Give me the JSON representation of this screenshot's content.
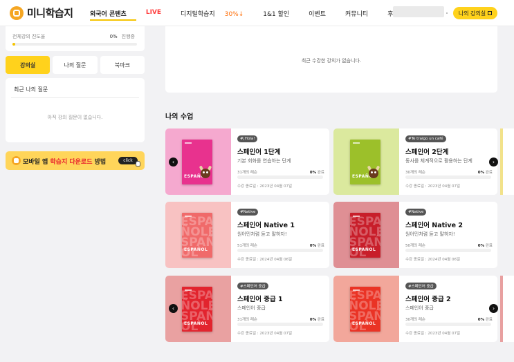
{
  "header": {
    "logo_text": "미니학습지",
    "nav": [
      {
        "label": "외국어 콘텐츠",
        "style": "active"
      },
      {
        "label": "LIVE",
        "style": "live"
      },
      {
        "label": "디지털학습지 ",
        "accent": "30%↓",
        "style": "normal"
      },
      {
        "label": "1&1 할인",
        "style": "normal"
      },
      {
        "label": "이벤트",
        "style": "normal"
      },
      {
        "label": "커뮤니티",
        "style": "normal"
      },
      {
        "label": "후기",
        "style": "normal"
      }
    ],
    "my_class_button": "나의 강의실"
  },
  "sidebar": {
    "progress_label": "전체강의 진도율",
    "progress_value": "0%",
    "progress_status": "진행중",
    "progress": 0,
    "tabs": [
      {
        "label": "강의실",
        "active": true
      },
      {
        "label": "나의 질문",
        "active": false
      },
      {
        "label": "북마크",
        "active": false
      }
    ],
    "questions_title": "최근 나의 질문",
    "questions_empty": "아직 강의 질문이 없습니다.",
    "banner": {
      "text_before": "모바일 앱 ",
      "text_red": "학습지 다운로드",
      "text_after": " 방법",
      "click_label": "click"
    }
  },
  "recent": {
    "empty_text": "최근 수강한 강의가 없습니다."
  },
  "my_classes": {
    "title": "나의 수업",
    "courses": [
      {
        "tag": "#¡Hola!",
        "title": "스페인어 1단계",
        "subtitle": "기본 회화를 연습하는 단계",
        "lessons": "31개의 레슨",
        "percent": "0%",
        "percent_suffix": "완료",
        "progress": 0,
        "end_date": "수강 종료일 : 2023년 04월 07일",
        "cover_text": "ESPAÑOL",
        "cover_color": "#e8328e",
        "bg_color": "#f5a9cf"
      },
      {
        "tag": "#Te traigo un café",
        "title": "스페인어 2단계",
        "subtitle": "동사를 체계적으로 활용하는 단계",
        "lessons": "30개의 레슨",
        "percent": "0%",
        "percent_suffix": "완료",
        "progress": 0,
        "end_date": "수강 종료일 : 2023년 04월 07일",
        "cover_text": "ESPAÑOL",
        "cover_color": "#9cc02a",
        "bg_color": "#dbe99e"
      },
      {
        "tag": "#Native",
        "title": "스페인어 Native 1",
        "subtitle": "원어민처럼 듣고 말하자!",
        "lessons": "51개의 레슨",
        "percent": "0%",
        "percent_suffix": "완료",
        "progress": 0,
        "end_date": "수강 종료일 : 2024년 04월 06일",
        "cover_text": "ESPAÑOL",
        "cover_color": "#f06a6a",
        "bg_color": "#f8c2c2"
      },
      {
        "tag": "#Native",
        "title": "스페인어 Native 2",
        "subtitle": "원어민처럼 듣고 말하자!",
        "lessons": "50개의 레슨",
        "percent": "0%",
        "percent_suffix": "완료",
        "progress": 0,
        "end_date": "수강 종료일 : 2024년 04월 06일",
        "cover_text": "ESPAÑOL",
        "cover_color": "#c81e2a",
        "bg_color": "#df8f94"
      },
      {
        "tag": "#스페인어 중급",
        "title": "스페인어 중급 1",
        "subtitle": "스페인어 중급",
        "lessons": "31개의 레슨",
        "percent": "0%",
        "percent_suffix": "완료",
        "progress": 0,
        "end_date": "수강 종료일 : 2023년 04월 07일",
        "cover_text": "ESPAÑOL",
        "cover_color": "#e2242e",
        "bg_color": "#e9a1a1"
      },
      {
        "tag": "#스페인어 중급",
        "title": "스페인어 중급 2",
        "subtitle": "스페인어 중급",
        "lessons": "30개의 레슨",
        "percent": "0%",
        "percent_suffix": "완료",
        "progress": 0,
        "end_date": "수강 종료일 : 2023년 04월 07일",
        "cover_text": "ESPAÑOL",
        "cover_color": "#ea3325",
        "bg_color": "#f2a79b"
      }
    ]
  },
  "colors": {
    "accent_yellow": "#ffd21c",
    "live_red": "#ff3d3d"
  },
  "icons": {
    "prev": "chevron-left-icon",
    "next": "chevron-right-icon"
  }
}
